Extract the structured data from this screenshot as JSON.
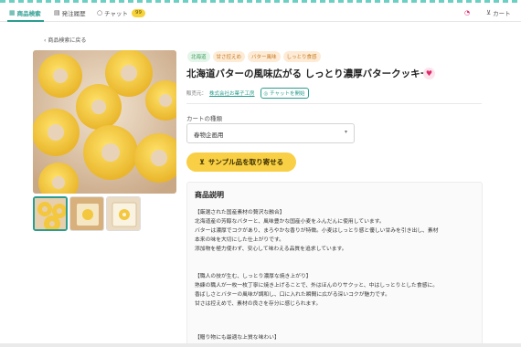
{
  "header": {
    "nav": [
      {
        "label": "商品検索",
        "icon": "grid-icon"
      },
      {
        "label": "発注履歴",
        "icon": "receipt-icon"
      },
      {
        "label": "チャット",
        "icon": "chat-icon",
        "badge": "99"
      }
    ],
    "cart_label": "カート",
    "notification_icon": "bell-icon"
  },
  "back_link": "商品検索に戻る",
  "product": {
    "tags": [
      "北海道",
      "甘さ控えめ",
      "バター風味",
      "しっとり食感"
    ],
    "title": "北海道バターの風味広がる しっとり濃厚バタークッキー",
    "maker_label": "販売元：",
    "maker_name": "株式会社お菓子工房",
    "chat_button": "チャットを開始"
  },
  "cart_type": {
    "label": "カートの種類",
    "selected": "春物企画用"
  },
  "sample_button": "サンプル品を取り寄せる",
  "description": {
    "title": "商品説明",
    "lines": [
      "【厳選された国産素材の贅沢な融合】",
      "北海道産の芳醇なバターと、風味豊かな国産小麦をふんだんに使用しています。",
      "バターは濃厚でコクがあり、まろやかな香りが特徴。小麦はしっとり感と優しい甘みを引き出し、素材",
      "本来の味を大切にした仕上がりです。",
      "添加物を極力使わず、安心して味わえる品質を追求しています。",
      "",
      "【職人の技が生む、しっとり濃厚な焼き上がり】",
      "熟練の職人が一枚一枚丁寧に焼き上げることで、外はほんのりサクッと、中はしっとりとした食感に。",
      "香ばしさとバターの風味が調和し、口に入れた瞬間に広がる深いコクが魅力です。",
      "甘さは控えめで、素材の良さを存分に感じられます。",
      "",
      "【贈り物にも最適な上質な味わい】"
    ]
  },
  "colors": {
    "accent": "#2a9d8f",
    "button": "#f8cf45",
    "heart": "#e2286c"
  }
}
